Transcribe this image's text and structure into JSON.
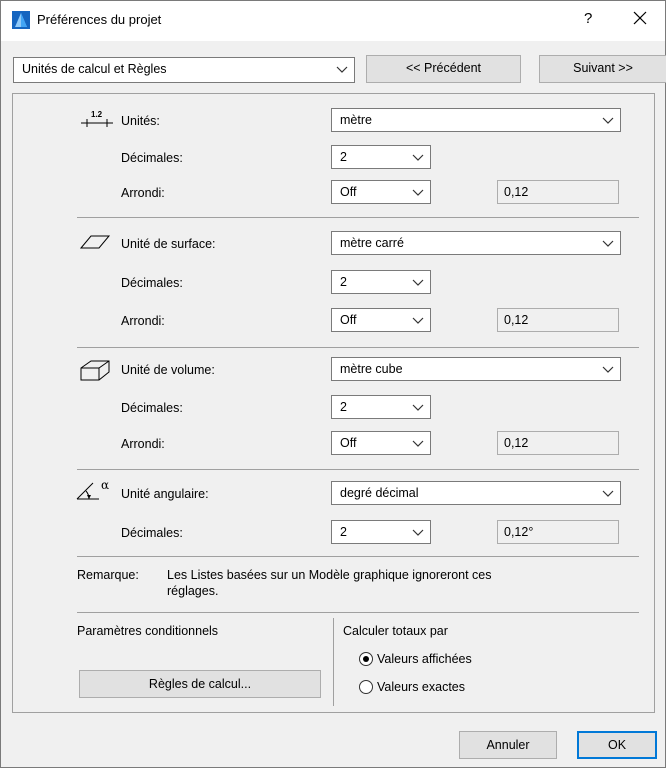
{
  "window": {
    "title": "Préférences du projet",
    "help": "?",
    "accent": "#0078d7"
  },
  "toolbar": {
    "page_select": "Unités de calcul et Règles",
    "prev_label": "<< Précédent",
    "next_label": "Suivant >>"
  },
  "sections": {
    "units": {
      "label": "Unités:",
      "value": "mètre",
      "decimals_label": "Décimales:",
      "decimals": "2",
      "rounding_label": "Arrondi:",
      "rounding": "Off",
      "preview": "0,12"
    },
    "surface": {
      "label": "Unité de surface:",
      "value": "mètre carré",
      "decimals_label": "Décimales:",
      "decimals": "2",
      "rounding_label": "Arrondi:",
      "rounding": "Off",
      "preview": "0,12"
    },
    "volume": {
      "label": "Unité de volume:",
      "value": "mètre cube",
      "decimals_label": "Décimales:",
      "decimals": "2",
      "rounding_label": "Arrondi:",
      "rounding": "Off",
      "preview": "0,12"
    },
    "angle": {
      "label": "Unité angulaire:",
      "value": "degré décimal",
      "decimals_label": "Décimales:",
      "decimals": "2",
      "preview": "0,12°"
    }
  },
  "remark": {
    "label": "Remarque:",
    "text_line1": "Les Listes basées sur un Modèle graphique ignoreront ces",
    "text_line2": "réglages."
  },
  "conditional": {
    "label": "Paramètres conditionnels",
    "rules_button": "Règles de calcul..."
  },
  "totals": {
    "label": "Calculer totaux par",
    "option_displayed": "Valeurs affichées",
    "option_exact": "Valeurs exactes",
    "selected": "Valeurs affichées"
  },
  "footer": {
    "cancel": "Annuler",
    "ok": "OK"
  },
  "icons": {
    "app": "archicad-icon",
    "units": "dimension-icon",
    "surface": "surface-icon",
    "volume": "volume-icon",
    "angle": "angle-icon",
    "units_icon_text": "1.2",
    "angle_icon_text": "α"
  }
}
